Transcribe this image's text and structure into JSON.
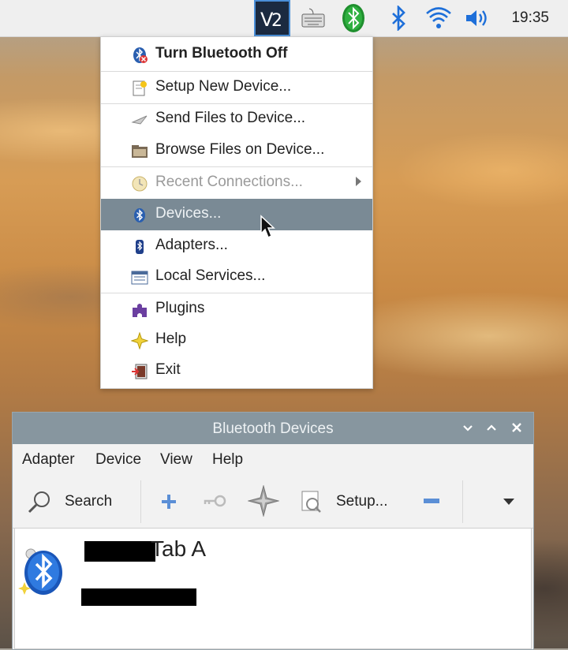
{
  "panel": {
    "tray_icons": [
      "vnc-icon",
      "keyboard-icon",
      "bluetooth-tray-icon",
      "bluetooth-icon",
      "wifi-icon",
      "volume-icon"
    ],
    "clock": "19:35"
  },
  "menu": {
    "items": [
      {
        "label": "Turn Bluetooth Off",
        "icon": "bluetooth-off-icon"
      },
      {
        "label": "Setup New Device...",
        "icon": "setup-device-icon"
      },
      {
        "label": "Send Files to Device...",
        "icon": "send-files-icon"
      },
      {
        "label": "Browse Files on Device...",
        "icon": "folder-icon"
      },
      {
        "label": "Recent Connections...",
        "icon": "recent-connections-icon"
      },
      {
        "label": "Devices...",
        "icon": "bluetooth-small-icon"
      },
      {
        "label": "Adapters...",
        "icon": "adapter-icon"
      },
      {
        "label": "Local Services...",
        "icon": "local-services-icon"
      },
      {
        "label": "Plugins",
        "icon": "plugin-icon"
      },
      {
        "label": "Help",
        "icon": "help-icon"
      },
      {
        "label": "Exit",
        "icon": "exit-icon"
      }
    ],
    "hovered": "Devices..."
  },
  "window": {
    "title": "Bluetooth Devices",
    "menubar": [
      "Adapter",
      "Device",
      "View",
      "Help"
    ],
    "toolbar": {
      "search_label": "Search",
      "setup_label": "Setup..."
    },
    "device": {
      "name_suffix": "Tab A"
    }
  },
  "colors": {
    "menu_highlight": "#7a8a95",
    "titlebar": "#87969f",
    "bluetooth_blue": "#1e6fd9"
  }
}
